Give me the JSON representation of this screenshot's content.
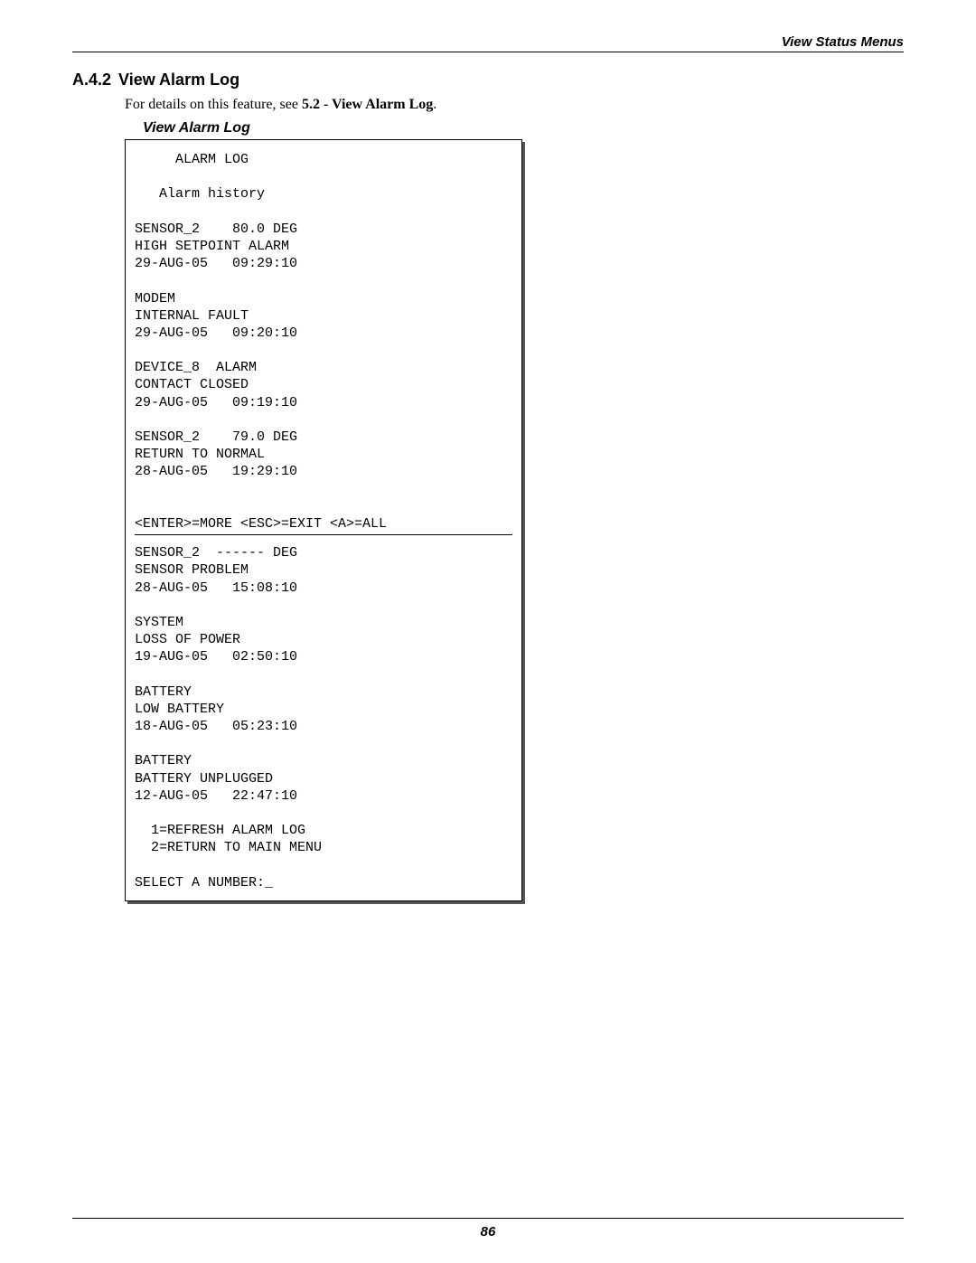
{
  "header": {
    "breadcrumb": "View Status Menus"
  },
  "section": {
    "number": "A.4.2",
    "title": "View Alarm Log",
    "intro_prefix": "For details on this feature, see ",
    "intro_bold": "5.2 - View Alarm Log",
    "intro_suffix": "."
  },
  "sub_heading": "View Alarm Log",
  "terminal": {
    "title": "     ALARM LOG",
    "subtitle": "   Alarm history",
    "entries_top": [
      "SENSOR_2    80.0 DEG\nHIGH SETPOINT ALARM\n29-AUG-05   09:29:10",
      "MODEM\nINTERNAL FAULT\n29-AUG-05   09:20:10",
      "DEVICE_8  ALARM\nCONTACT CLOSED\n29-AUG-05   09:19:10",
      "SENSOR_2    79.0 DEG\nRETURN TO NORMAL\n28-AUG-05   19:29:10"
    ],
    "nav_line": "<ENTER>=MORE <ESC>=EXIT <A>=ALL",
    "entries_bottom": [
      "SENSOR_2  ------ DEG\nSENSOR PROBLEM\n28-AUG-05   15:08:10",
      "SYSTEM\nLOSS OF POWER\n19-AUG-05   02:50:10",
      "BATTERY\nLOW BATTERY\n18-AUG-05   05:23:10",
      "BATTERY\nBATTERY UNPLUGGED\n12-AUG-05   22:47:10"
    ],
    "menu1": "  1=REFRESH ALARM LOG",
    "menu2": "  2=RETURN TO MAIN MENU",
    "prompt": "SELECT A NUMBER:_"
  },
  "footer": {
    "page_number": "86"
  }
}
